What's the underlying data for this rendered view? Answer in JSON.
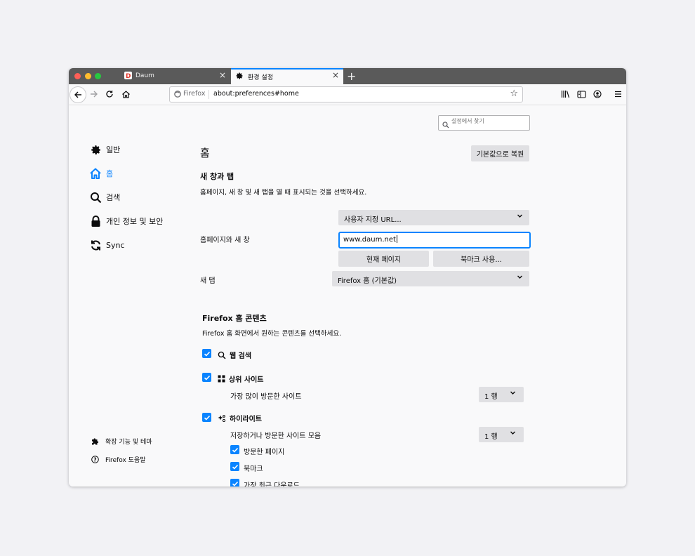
{
  "colors": {
    "accent": "#0a84ff",
    "titlebar": "#5a5a5a",
    "dot_red": "#ff5f57",
    "dot_yellow": "#febc2e",
    "dot_green": "#28c840"
  },
  "tabs": [
    {
      "label": "Daum",
      "icon": "daum-favicon-icon"
    },
    {
      "label": "환경 설정",
      "icon": "gear-icon"
    }
  ],
  "toolbar": {
    "identity": "Firefox",
    "url": "about:preferences#home"
  },
  "search": {
    "placeholder": "설정에서 찾기"
  },
  "sidebar": {
    "items": [
      {
        "label": "일반",
        "icon": "gear-icon"
      },
      {
        "label": "홈",
        "icon": "home-icon"
      },
      {
        "label": "검색",
        "icon": "search-icon"
      },
      {
        "label": "개인 정보 및 보안",
        "icon": "lock-icon"
      },
      {
        "label": "Sync",
        "icon": "sync-icon"
      }
    ],
    "footer": [
      {
        "label": "확장 기능 및 테마",
        "icon": "puzzle-icon"
      },
      {
        "label": "Firefox 도움말",
        "icon": "help-icon"
      }
    ]
  },
  "main": {
    "title": "홈",
    "restore_button": "기본값으로 복원",
    "newwin": {
      "heading": "새 창과 탭",
      "description": "홈페이지, 새 창 및 새 탭을 열 때 표시되는 것을 선택하세요.",
      "homepage_label": "홈페이지와 새 창",
      "homepage_select": "사용자 지정 URL...",
      "homepage_value": "www.daum.net",
      "current_page_button": "현재 페이지",
      "bookmark_button": "북마크 사용...",
      "newtab_label": "새 탭",
      "newtab_select": "Firefox 홈 (기본값)"
    },
    "home_content": {
      "heading": "Firefox 홈 콘텐츠",
      "description": "Firefox 홈 화면에서 원하는 콘텐츠를 선택하세요.",
      "web_search": "웹 검색",
      "top_sites": "상위 사이트",
      "top_sites_desc": "가장 많이 방문한 사이트",
      "top_sites_rows": "1 행",
      "highlights": "하이라이트",
      "highlights_desc": "저장하거나 방문한 사이트 모음",
      "highlights_rows": "1 행",
      "visited_pages": "방문한 페이지",
      "bookmarks": "북마크",
      "recent_downloads": "가장 최근 다운로드"
    }
  }
}
